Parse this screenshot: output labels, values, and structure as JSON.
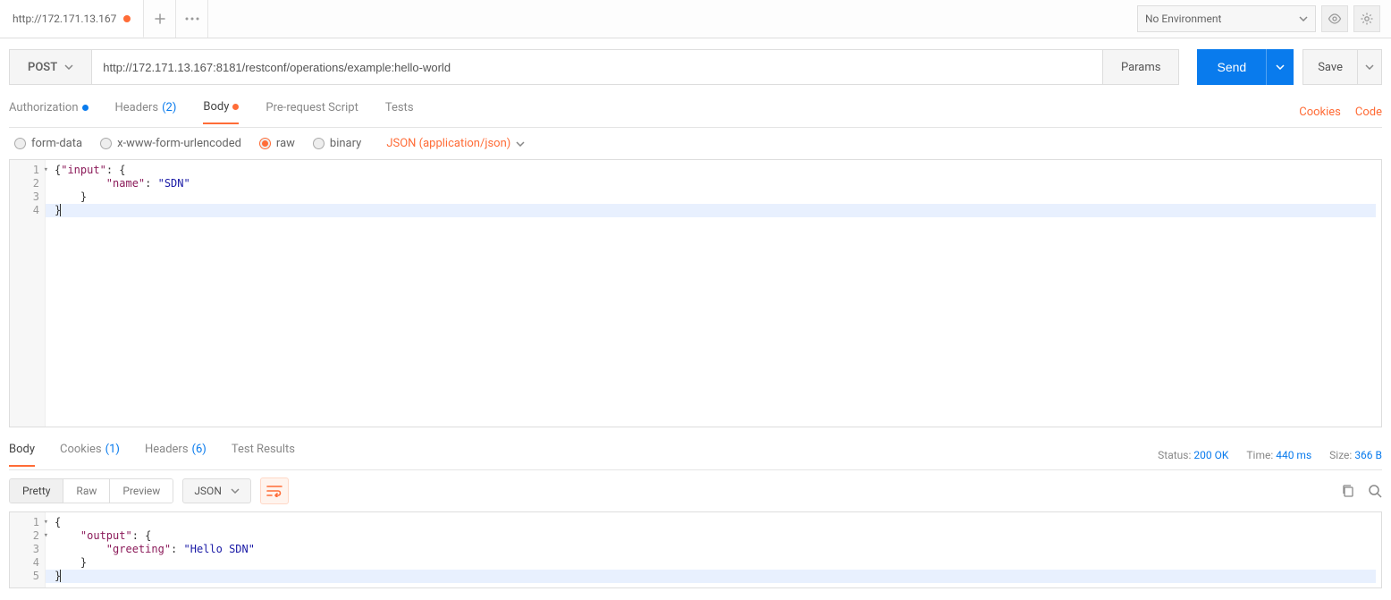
{
  "tab": {
    "title": "http://172.171.13.167"
  },
  "env": {
    "selected": "No Environment"
  },
  "request": {
    "method": "POST",
    "url": "http://172.171.13.167:8181/restconf/operations/example:hello-world",
    "params_label": "Params",
    "send_label": "Send",
    "save_label": "Save"
  },
  "req_tabs": {
    "authorization": "Authorization",
    "headers": "Headers",
    "headers_count": "(2)",
    "body": "Body",
    "prerequest": "Pre-request Script",
    "tests": "Tests"
  },
  "req_links": {
    "cookies": "Cookies",
    "code": "Code"
  },
  "body_types": {
    "formdata": "form-data",
    "urlencoded": "x-www-form-urlencoded",
    "raw": "raw",
    "binary": "binary",
    "content_type": "JSON (application/json)"
  },
  "request_body": {
    "lines": [
      "1",
      "2",
      "3",
      "4"
    ],
    "l1_open": "{",
    "l1_key": "\"input\"",
    "l1_after": ": {",
    "l2_key": "\"name\"",
    "l2_sep": ": ",
    "l2_val": "\"SDN\"",
    "l3": "    }",
    "l4": "}"
  },
  "resp_tabs": {
    "body": "Body",
    "cookies": "Cookies",
    "cookies_count": "(1)",
    "headers": "Headers",
    "headers_count": "(6)",
    "tests": "Test Results"
  },
  "resp_meta": {
    "status_label": "Status:",
    "status_value": "200 OK",
    "time_label": "Time:",
    "time_value": "440 ms",
    "size_label": "Size:",
    "size_value": "366 B"
  },
  "resp_ctrl": {
    "pretty": "Pretty",
    "raw": "Raw",
    "preview": "Preview",
    "format": "JSON"
  },
  "response_body": {
    "lines": [
      "1",
      "2",
      "3",
      "4",
      "5"
    ],
    "l1": "{",
    "l2_key": "\"output\"",
    "l2_after": ": {",
    "l3_key": "\"greeting\"",
    "l3_sep": ": ",
    "l3_val": "\"Hello SDN\"",
    "l4": "    }",
    "l5": "}"
  }
}
